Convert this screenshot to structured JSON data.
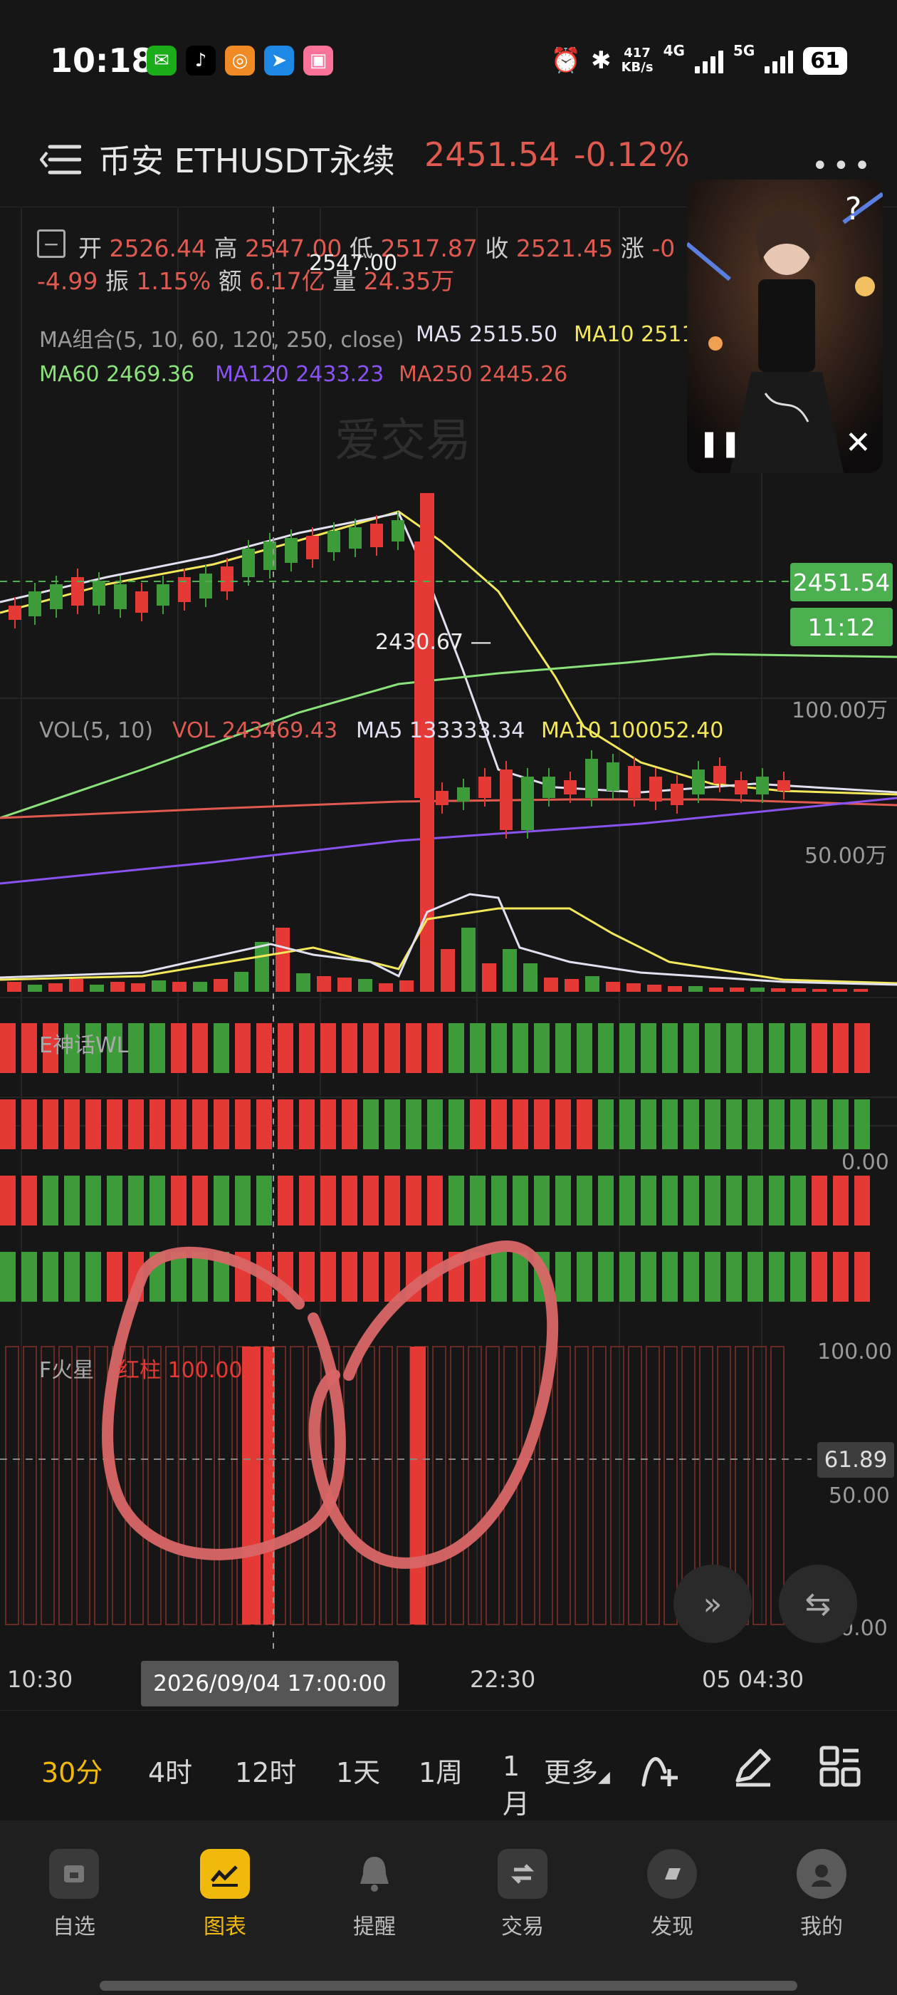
{
  "status": {
    "time": "10:18",
    "speed_top": "417",
    "speed_unit": "KB/s",
    "net1": "4G",
    "net2": "5G",
    "battery": "61",
    "apps": [
      {
        "name": "wechat-icon",
        "color": "#1aad19",
        "glyph": "✉"
      },
      {
        "name": "tiktok-icon",
        "color": "#000000",
        "glyph": "♪"
      },
      {
        "name": "orange-app-icon",
        "color": "#f08a24",
        "glyph": "◎"
      },
      {
        "name": "blue-app-icon",
        "color": "#1e88e5",
        "glyph": "➤"
      },
      {
        "name": "bilibili-icon",
        "color": "#fb7299",
        "glyph": "▣"
      }
    ]
  },
  "header": {
    "title": "币安 ETHUSDT永续",
    "price": "2451.54",
    "change": "-0.12%"
  },
  "ohlc": {
    "open_label": "开",
    "open": "2526.44",
    "high_label": "高",
    "high": "2547.00",
    "low_label": "低",
    "low": "2517.87",
    "close_label": "收",
    "close": "2521.45",
    "chg_label": "涨",
    "chg": "-0",
    "chg2": "-4.99",
    "amp_label": "振",
    "amp": "1.15%",
    "amount_label": "额",
    "amount": "6.17亿",
    "vol_label": "量",
    "vol": "24.35万"
  },
  "ma": {
    "group_label": "MA组合(5, 10, 60, 120, 250, close)",
    "ma5": "MA5 2515.50",
    "ma10": "MA10 2511",
    "ma60": "MA60 2469.36",
    "ma120": "MA120 2433.23",
    "ma250": "MA250 2445.26"
  },
  "annotations": {
    "high_mark": "2547.00",
    "low_mark": "2430.67 —",
    "price_tag": "2451.54",
    "countdown": "11:12",
    "watermark": "爱交易"
  },
  "vol_panel": {
    "label": "VOL(5, 10)",
    "vol": "VOL 243469.43",
    "ma5": "MA5 133333.34",
    "ma10": "MA10 100052.40",
    "axis_top": "100.00万",
    "axis_mid": "50.00万"
  },
  "e_panel": {
    "label": "E神话WL",
    "zero": "0.00"
  },
  "f_panel": {
    "label": "F火星",
    "value_label": "红柱 100.00",
    "axis_top": "100.00",
    "axis_mid": "50.00",
    "axis_bottom": "0.00",
    "current": "61.89"
  },
  "timeaxis": {
    "labels": [
      "10:30",
      "22:30",
      "05 04:30"
    ],
    "crosshair": "2026/09/04 17:00:00"
  },
  "periods": {
    "items": [
      "30分",
      "4时",
      "12时",
      "1天",
      "1周",
      "1月"
    ],
    "active": "30分",
    "more": "更多"
  },
  "nav": {
    "items": [
      "自选",
      "图表",
      "提醒",
      "交易",
      "发现",
      "我的"
    ],
    "active": "图表"
  },
  "colors": {
    "up": "#3e9b3a",
    "down": "#e53935",
    "price_red": "#e05a50",
    "ma5": "#e0e0f0",
    "ma10": "#f4e85a",
    "ma60": "#8be27a",
    "ma120": "#8a52f0",
    "ma250": "#e05a50",
    "accent": "#f0b90b"
  }
}
